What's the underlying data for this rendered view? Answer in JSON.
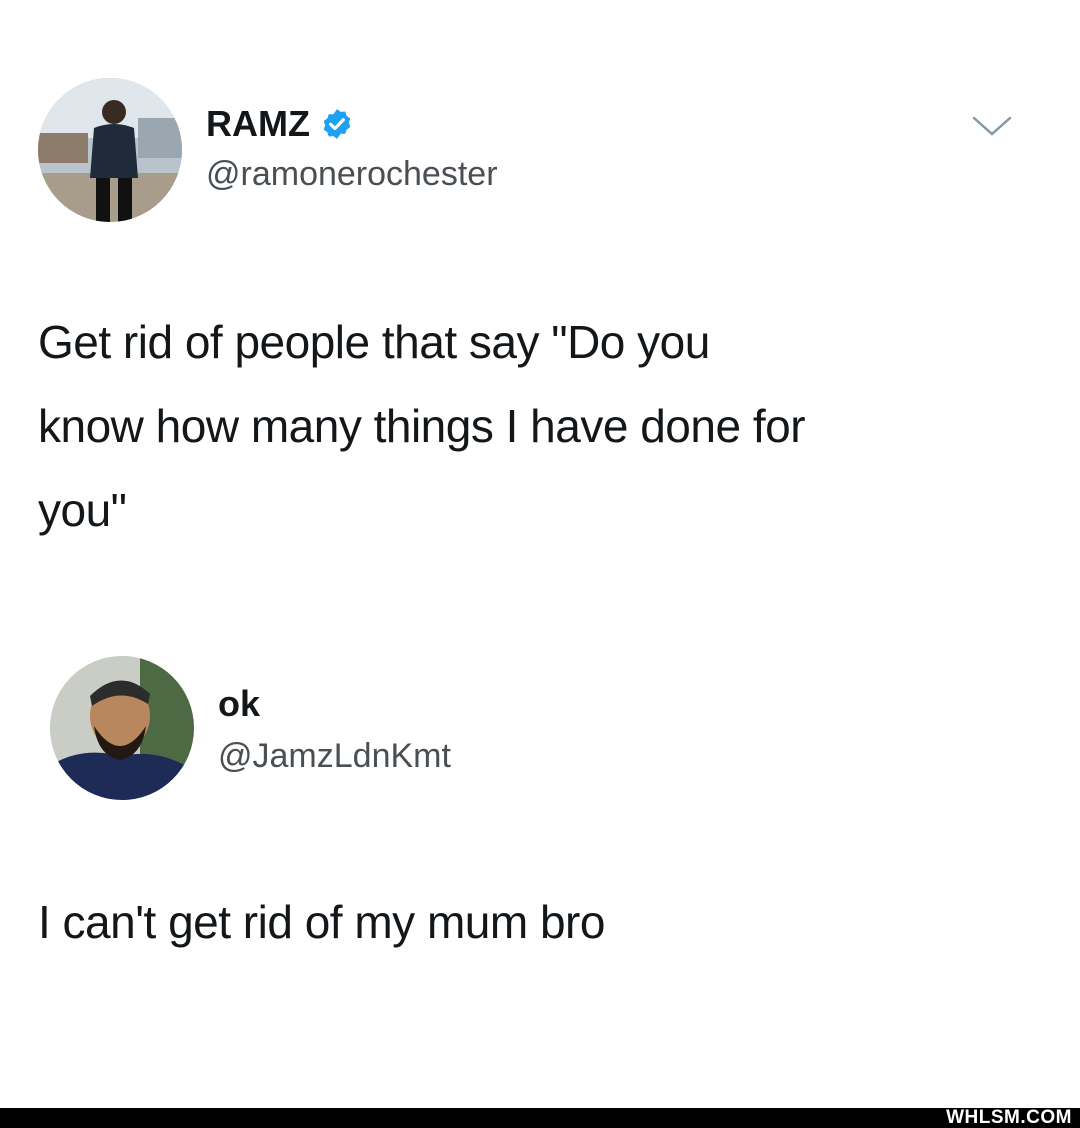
{
  "tweets": [
    {
      "display_name": "RAMZ",
      "verified": true,
      "handle": "@ramonerochester",
      "text_lines": [
        "Get rid of people that say \"Do you",
        "know how many things I have done for",
        "you\""
      ],
      "menu_icon": "chevron-down-icon"
    },
    {
      "display_name": "ok",
      "verified": false,
      "handle": "@JamzLdnKmt",
      "text_lines": [
        "I can't get rid of my mum bro"
      ]
    }
  ],
  "watermark": "WHLSM.COM",
  "colors": {
    "background": "#ffffff",
    "text": "#14171a",
    "secondary_text": "#4a4f54",
    "verified_blue": "#1da1f2",
    "footer": "#000000"
  }
}
